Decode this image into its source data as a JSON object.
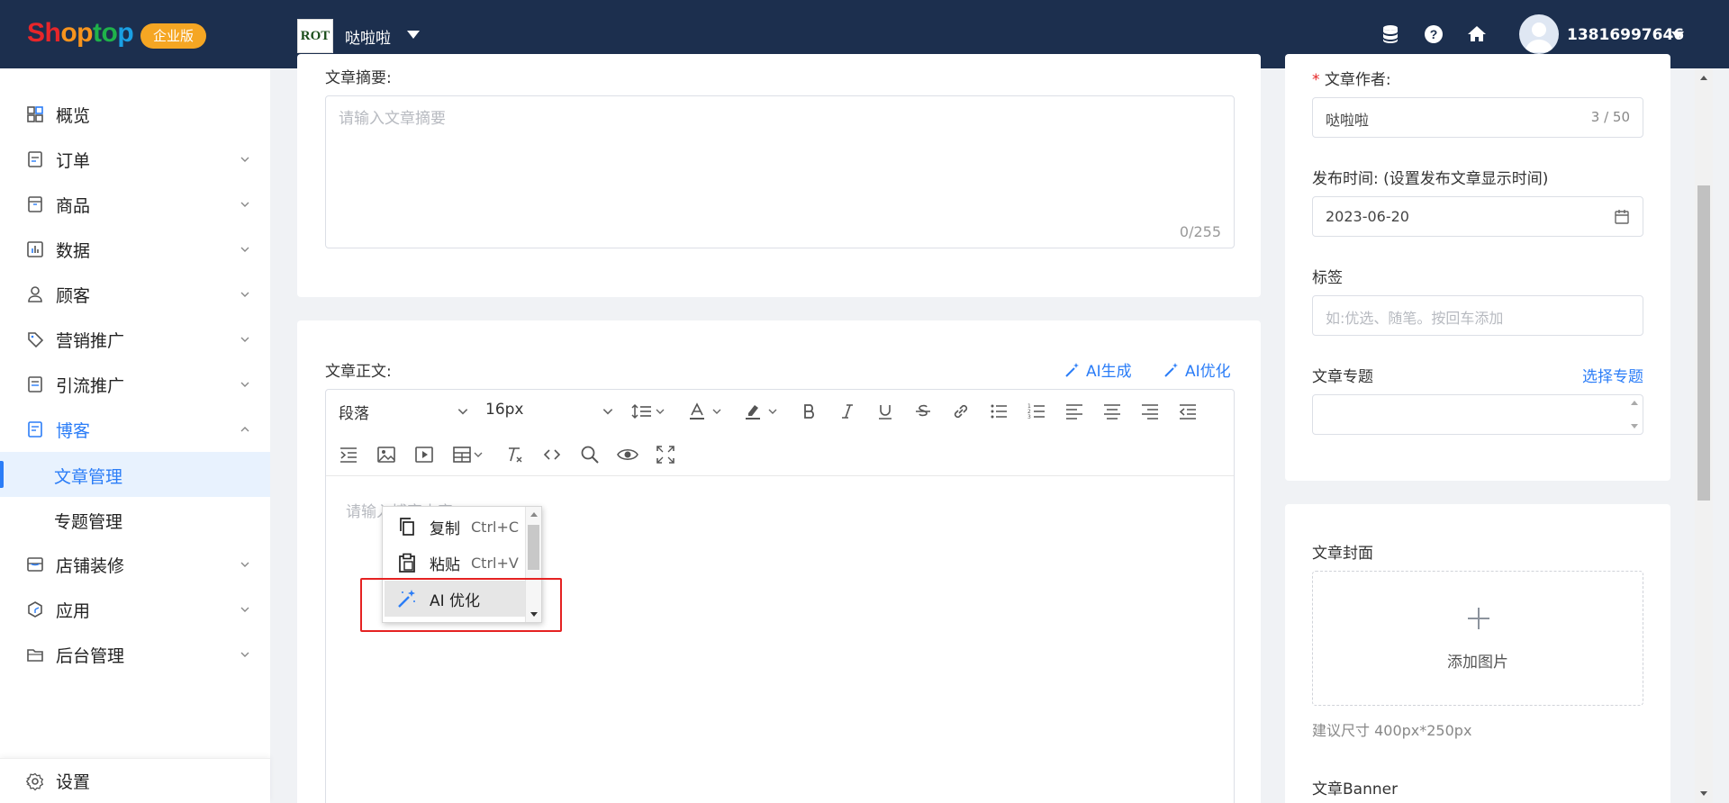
{
  "header": {
    "logo": [
      "Sh",
      "op",
      "to",
      "p"
    ],
    "edition_badge": "企业版",
    "shop_logo_text": "ROT",
    "shop_name": "哒啦啦",
    "user_phone": "13816997646"
  },
  "sidebar": {
    "items": [
      {
        "label": "概览"
      },
      {
        "label": "订单"
      },
      {
        "label": "商品"
      },
      {
        "label": "数据"
      },
      {
        "label": "顾客"
      },
      {
        "label": "营销推广"
      },
      {
        "label": "引流推广"
      },
      {
        "label": "博客"
      },
      {
        "label": "店铺装修"
      },
      {
        "label": "应用"
      },
      {
        "label": "后台管理"
      }
    ],
    "blog_children": [
      {
        "label": "文章管理"
      },
      {
        "label": "专题管理"
      }
    ],
    "settings_label": "设置"
  },
  "summary": {
    "label": "文章摘要:",
    "placeholder": "请输入文章摘要",
    "counter": "0/255"
  },
  "body_section": {
    "label": "文章正文:",
    "ai_generate": "AI生成",
    "ai_optimize": "AI优化",
    "paragraph_select": "段落",
    "font_size_select": "16px",
    "placeholder": "请输入博客内容"
  },
  "context_menu": {
    "items": [
      {
        "label": "复制",
        "shortcut": "Ctrl+C"
      },
      {
        "label": "粘贴",
        "shortcut": "Ctrl+V"
      },
      {
        "label": "AI 优化",
        "shortcut": ""
      }
    ]
  },
  "right_panel": {
    "author_label": "文章作者:",
    "author_required_mark": "*",
    "author_value": "哒啦啦",
    "author_counter": "3 / 50",
    "publish_label": "发布时间:",
    "publish_hint": "(设置发布文章显示时间)",
    "publish_value": "2023-06-20",
    "tags_label": "标签",
    "tags_placeholder": "如:优选、随笔。按回车添加",
    "topic_label": "文章专题",
    "topic_action": "选择专题",
    "cover_label": "文章封面",
    "cover_add": "添加图片",
    "cover_hint": "建议尺寸 400px*250px",
    "banner_label": "文章Banner"
  },
  "colors": {
    "header_bg": "#1c2f4e",
    "accent": "#2b7df7",
    "badge": "#f5a623",
    "highlight": "#e52222"
  }
}
